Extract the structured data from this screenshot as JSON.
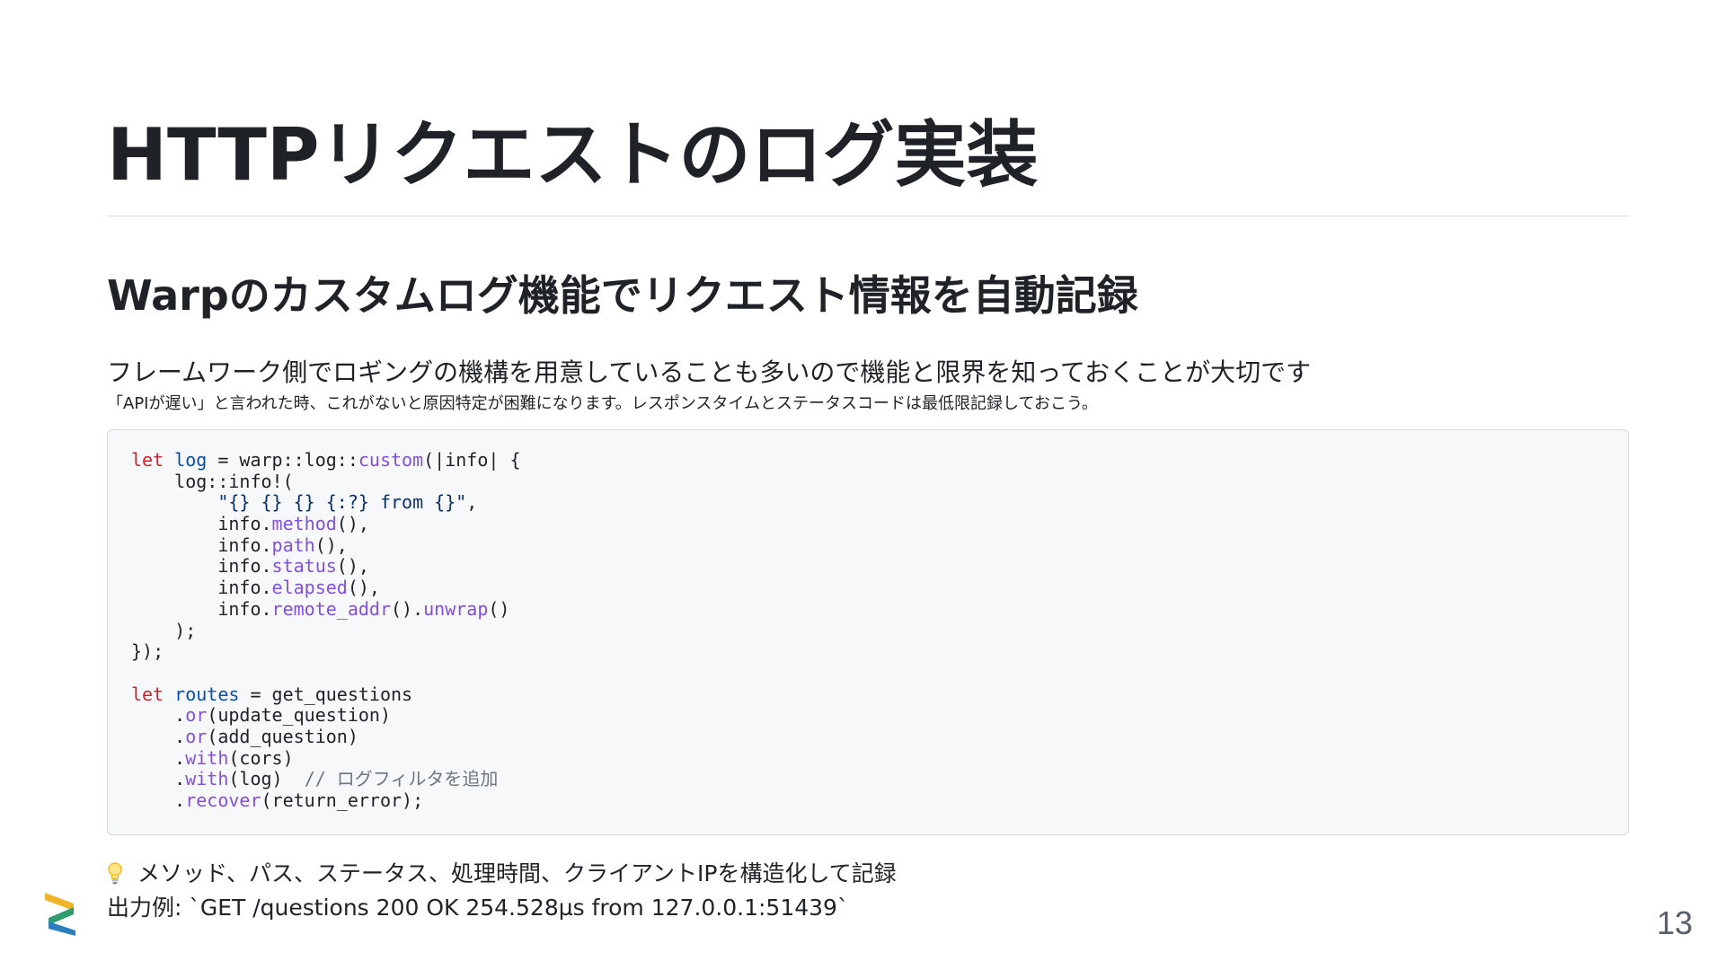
{
  "slide": {
    "title": "HTTPリクエストのログ実装",
    "subtitle": "Warpのカスタムログ機能でリクエスト情報を自動記録",
    "lead": "フレームワーク側でロギングの機構を用意していることも多いので機能と限界を知っておくことが大切です",
    "note": "「APIが遅い」と言われた時、これがないと原因特定が困難になります。レスポンスタイムとステータスコードは最低限記録しておこう。",
    "code": {
      "language": "rust",
      "lines": [
        [
          {
            "t": "let",
            "k": "keyword"
          },
          {
            "t": " "
          },
          {
            "t": "log",
            "k": "var"
          },
          {
            "t": " = warp::log::"
          },
          {
            "t": "custom",
            "k": "fn"
          },
          {
            "t": "(|info| {"
          }
        ],
        [
          {
            "t": "    log::info!("
          }
        ],
        [
          {
            "t": "        "
          },
          {
            "t": "\"{} {} {} {:?} from {}\"",
            "k": "string"
          },
          {
            "t": ","
          }
        ],
        [
          {
            "t": "        info."
          },
          {
            "t": "method",
            "k": "fn"
          },
          {
            "t": "(),"
          }
        ],
        [
          {
            "t": "        info."
          },
          {
            "t": "path",
            "k": "fn"
          },
          {
            "t": "(),"
          }
        ],
        [
          {
            "t": "        info."
          },
          {
            "t": "status",
            "k": "fn"
          },
          {
            "t": "(),"
          }
        ],
        [
          {
            "t": "        info."
          },
          {
            "t": "elapsed",
            "k": "fn"
          },
          {
            "t": "(),"
          }
        ],
        [
          {
            "t": "        info."
          },
          {
            "t": "remote_addr",
            "k": "fn"
          },
          {
            "t": "()."
          },
          {
            "t": "unwrap",
            "k": "fn"
          },
          {
            "t": "()"
          }
        ],
        [
          {
            "t": "    );"
          }
        ],
        [
          {
            "t": "});"
          }
        ],
        [],
        [
          {
            "t": "let",
            "k": "keyword"
          },
          {
            "t": " "
          },
          {
            "t": "routes",
            "k": "var"
          },
          {
            "t": " = get_questions"
          }
        ],
        [
          {
            "t": "    ."
          },
          {
            "t": "or",
            "k": "fn"
          },
          {
            "t": "(update_question)"
          }
        ],
        [
          {
            "t": "    ."
          },
          {
            "t": "or",
            "k": "fn"
          },
          {
            "t": "(add_question)"
          }
        ],
        [
          {
            "t": "    ."
          },
          {
            "t": "with",
            "k": "fn"
          },
          {
            "t": "(cors)"
          }
        ],
        [
          {
            "t": "    ."
          },
          {
            "t": "with",
            "k": "fn"
          },
          {
            "t": "(log)  "
          },
          {
            "t": "// ログフィルタを追加",
            "k": "comment"
          }
        ],
        [
          {
            "t": "    ."
          },
          {
            "t": "recover",
            "k": "fn"
          },
          {
            "t": "(return_error);"
          }
        ]
      ]
    },
    "bullet_icon": "lightbulb-icon",
    "bullet": "メソッド、パス、ステータス、処理時間、クライアントIPを構造化して記録",
    "example": "出力例: `GET /questions 200 OK 254.528µs from 127.0.0.1:51439`",
    "page_number": "13",
    "logo_icon": "brand-logo-icon",
    "colors": {
      "keyword": "#cf222e",
      "variable": "#0550ae",
      "function": "#8250df",
      "string": "#0a3069",
      "comment": "#6e7781",
      "code_background": "#f6f8fa"
    }
  }
}
